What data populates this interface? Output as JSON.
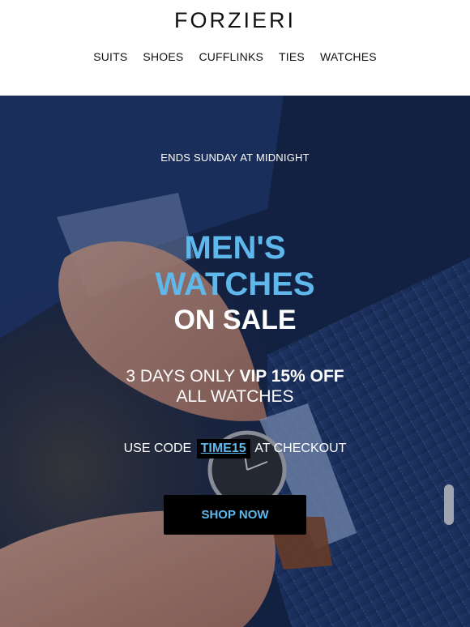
{
  "brand": {
    "logo": "FORZIERI"
  },
  "nav": {
    "items": [
      "SUITS",
      "SHOES",
      "CUFFLINKS",
      "TIES",
      "WATCHES"
    ]
  },
  "hero": {
    "eyebrow": "ENDS SUNDAY AT MIDNIGHT",
    "headline_line1": "MEN'S",
    "headline_line2": "WATCHES",
    "headline_line3": "ON SALE",
    "offer_prefix": "3 DAYS ONLY ",
    "offer_bold": "VIP 15% OFF",
    "offer_line2": "ALL WATCHES",
    "code_prefix": "USE CODE",
    "code": "TIME15",
    "code_suffix": "AT CHECKOUT",
    "cta_label": "SHOP NOW"
  },
  "colors": {
    "accent": "#5fb8ec",
    "hero_bg": "#1d3366",
    "button_bg": "#000000"
  }
}
